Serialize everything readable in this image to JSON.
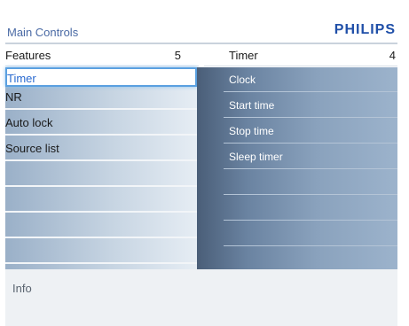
{
  "header": {
    "title": "Main Controls",
    "brand": "PHILIPS"
  },
  "left_column": {
    "heading": "Features",
    "count": "5",
    "items": [
      {
        "label": "Timer",
        "selected": true
      },
      {
        "label": "NR"
      },
      {
        "label": "Auto lock"
      },
      {
        "label": "Source list"
      },
      {
        "label": ""
      },
      {
        "label": ""
      },
      {
        "label": ""
      },
      {
        "label": ""
      }
    ]
  },
  "right_column": {
    "heading": "Timer",
    "count": "4",
    "items": [
      {
        "label": "Clock"
      },
      {
        "label": "Start time"
      },
      {
        "label": "Stop time"
      },
      {
        "label": "Sleep timer"
      },
      {
        "label": ""
      },
      {
        "label": ""
      },
      {
        "label": ""
      },
      {
        "label": ""
      }
    ]
  },
  "footer": {
    "info_label": "Info"
  },
  "colors": {
    "brand": "#1f4fa8",
    "selection_border": "#5aa0e0",
    "selection_text": "#2a6ad0"
  }
}
